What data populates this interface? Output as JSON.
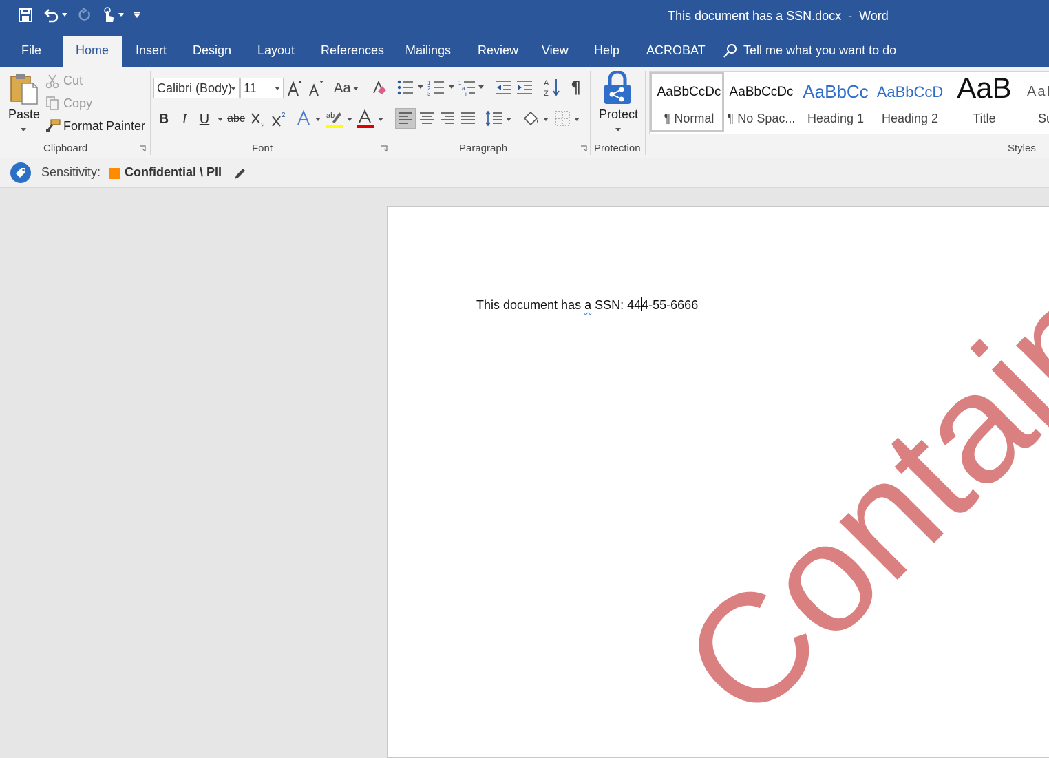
{
  "window": {
    "title": "This document has a SSN.docx  -  Word"
  },
  "tabs": [
    "File",
    "Home",
    "Insert",
    "Design",
    "Layout",
    "References",
    "Mailings",
    "Review",
    "View",
    "Help",
    "ACROBAT"
  ],
  "tell_me": {
    "placeholder": "Tell me what you want to do"
  },
  "clipboard": {
    "paste": "Paste",
    "cut": "Cut",
    "copy": "Copy",
    "format_painter": "Format Painter",
    "label": "Clipboard"
  },
  "font": {
    "name": "Calibri (Body)",
    "size": "11",
    "case": "Aa",
    "bold": "B",
    "italic": "I",
    "underline": "U",
    "strike": "abc",
    "label": "Font"
  },
  "paragraph": {
    "label": "Paragraph"
  },
  "protection": {
    "protect": "Protect",
    "label": "Protection"
  },
  "styles": {
    "label": "Styles",
    "items": [
      {
        "preview": "AaBbCcDc",
        "name": "¶ Normal"
      },
      {
        "preview": "AaBbCcDc",
        "name": "¶ No Spac..."
      },
      {
        "preview": "AaBbCc",
        "name": "Heading 1"
      },
      {
        "preview": "AaBbCcD",
        "name": "Heading 2"
      },
      {
        "preview": "AaB",
        "name": "Title"
      },
      {
        "preview": "AaBl",
        "name": "Su"
      }
    ]
  },
  "sensitivity": {
    "label": "Sensitivity:",
    "value": "Confidential \\ PII",
    "color": "#ff8c00"
  },
  "document": {
    "text_part1": "This document has ",
    "text_squiggle": "a",
    "text_part2": " SSN: 44",
    "text_part3": "4-55-6666",
    "watermark": "Contains PII"
  },
  "colors": {
    "accent": "#2b579a",
    "highlight": "#ffff00",
    "font_color": "#e00000",
    "watermark": "#d97a7a"
  }
}
